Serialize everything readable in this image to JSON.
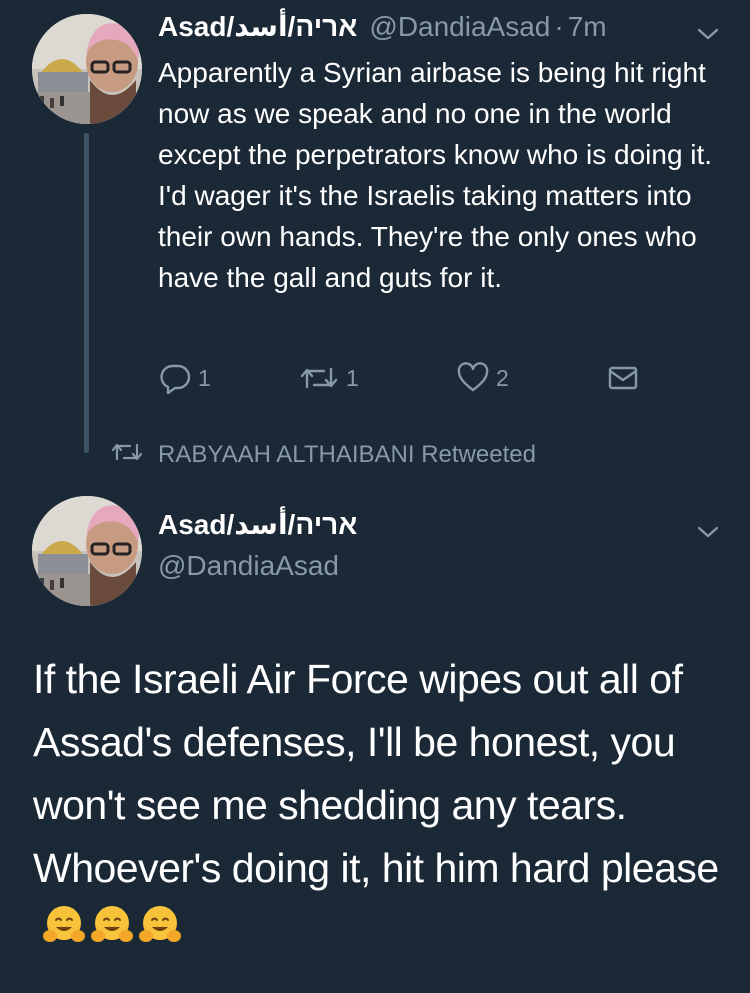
{
  "tweet1": {
    "name": "Asad/אריה/أسد",
    "handle": "@DandiaAsad",
    "separator": "·",
    "time": "7m",
    "text": "Apparently a Syrian airbase is being hit right now as we speak and no one in the world except the perpetrators know who is doing it. I'd wager it's the Israelis taking matters into their own hands. They're the only ones who have the gall and guts for it.",
    "actions": {
      "reply_count": "1",
      "retweet_count": "1",
      "like_count": "2"
    }
  },
  "retweet_banner": {
    "text": "RABYAAH ALTHAIBANI Retweeted"
  },
  "tweet2": {
    "name": "Asad/אריה/أسد",
    "handle": "@DandiaAsad",
    "text": "If the Israeli Air Force wipes out all of Assad's defenses, I'll be honest, you won't see me shedding any tears. Whoever's doing it, hit him hard please",
    "emojis": [
      "hugging-face-emoji",
      "hugging-face-emoji",
      "hugging-face-emoji"
    ]
  },
  "colors": {
    "background": "#1b2836",
    "secondary_text": "#8899a6",
    "thread_line": "#3d5466",
    "primary_text": "#ffffff"
  },
  "icons": [
    "reply-icon",
    "retweet-icon",
    "like-icon",
    "message-icon",
    "chevron-down-icon",
    "avatar"
  ]
}
